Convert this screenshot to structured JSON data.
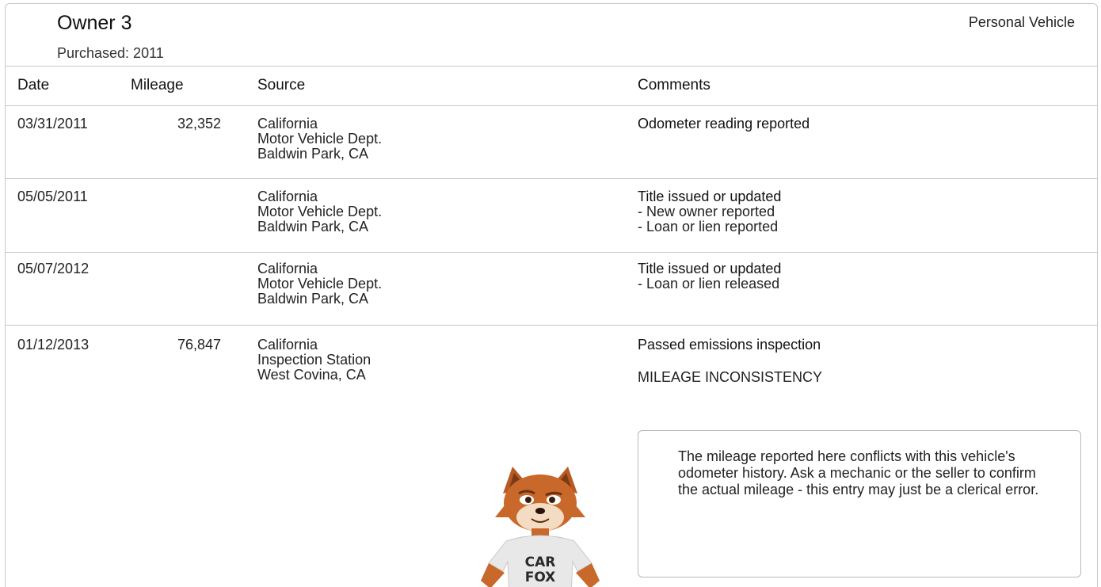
{
  "header": {
    "owner_title": "Owner 3",
    "purchased": "Purchased: 2011",
    "vehicle_type": "Personal Vehicle"
  },
  "columns": {
    "date": "Date",
    "mileage": "Mileage",
    "source": "Source",
    "comments": "Comments"
  },
  "rows": [
    {
      "date": "03/31/2011",
      "mileage": "32,352",
      "source": [
        "California",
        "Motor Vehicle Dept.",
        "Baldwin Park, CA"
      ],
      "comment_title": "Odometer reading reported",
      "comment_lines": []
    },
    {
      "date": "05/05/2011",
      "mileage": "",
      "source": [
        "California",
        "Motor Vehicle Dept.",
        "Baldwin Park, CA"
      ],
      "comment_title": "Title issued or updated",
      "comment_lines": [
        "- New owner reported",
        "- Loan or lien reported"
      ]
    },
    {
      "date": "05/07/2012",
      "mileage": "",
      "source": [
        "California",
        "Motor Vehicle Dept.",
        "Baldwin Park, CA"
      ],
      "comment_title": "Title issued or updated",
      "comment_lines": [
        "- Loan or lien released"
      ]
    },
    {
      "date": "01/12/2013",
      "mileage": "76,847",
      "source": [
        "California",
        "Inspection Station",
        "West Covina, CA"
      ],
      "comment_title": "Passed emissions inspection",
      "comment_lines": [],
      "warning": "MILEAGE INCONSISTENCY"
    }
  ],
  "alert": {
    "text": "The mileage reported here conflicts with this vehicle's odometer history. Ask a mechanic or the seller to confirm the actual mileage - this entry may just be a clerical error."
  },
  "mascot": {
    "shirt_line1": "CAR",
    "shirt_line2": "FOX",
    "colors": {
      "fur": "#c8682a",
      "fur_light": "#f3dcc2",
      "shirt": "#e8e8e8"
    }
  }
}
